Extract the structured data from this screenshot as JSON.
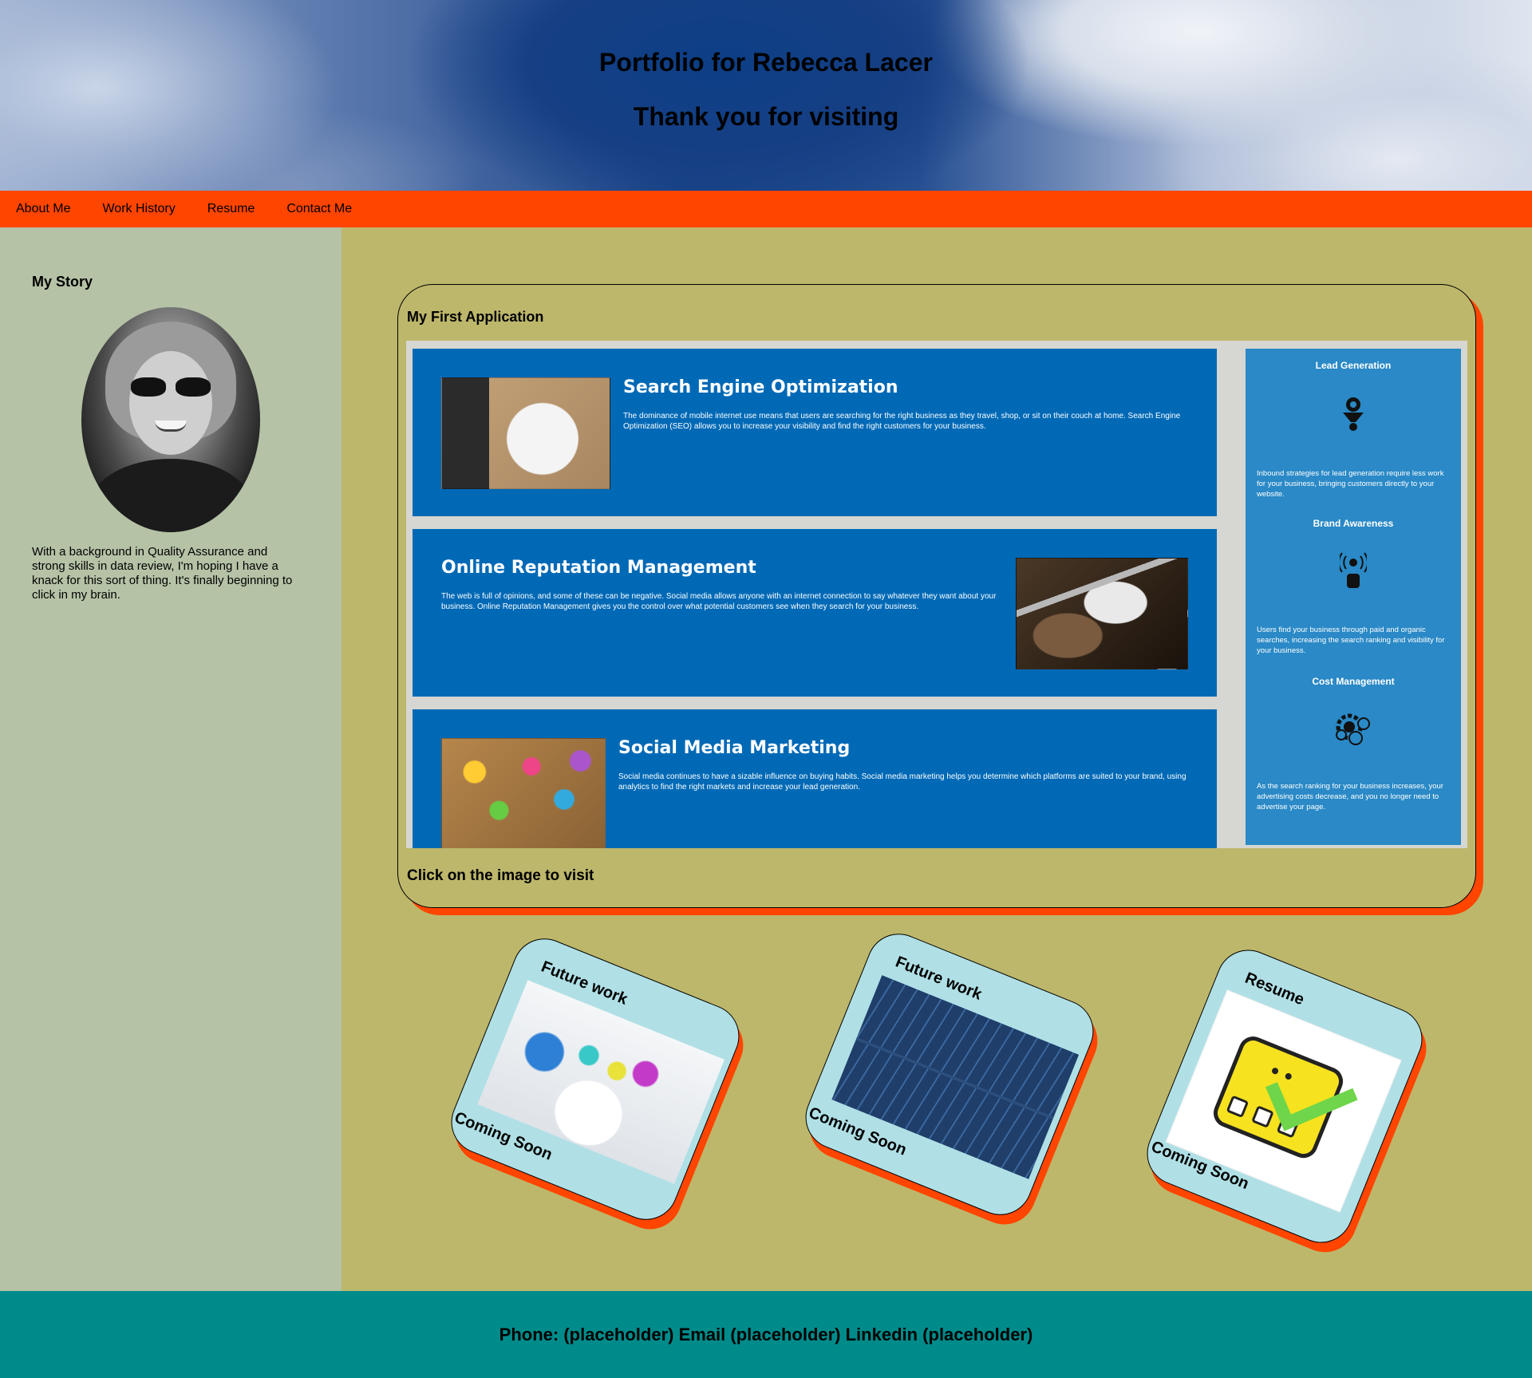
{
  "header": {
    "title": "Portfolio for Rebecca Lacer",
    "subtitle": "Thank you for visiting"
  },
  "nav": {
    "items": [
      "About Me",
      "Work History",
      "Resume",
      "Contact Me"
    ]
  },
  "sidebar": {
    "heading": "My Story",
    "story": "With a background in Quality Assurance and strong skills in data review, I'm hoping I have a knack for this sort of thing. It's finally beginning to click in my brain."
  },
  "main": {
    "title": "My First Application",
    "caption": "Click on the image to visit",
    "app": {
      "panels": [
        {
          "title": "Search Engine Optimization",
          "body": "The dominance of mobile internet use means that users are searching for the right business as they travel, shop, or sit on their couch at home. Search Engine Optimization (SEO) allows you to increase your visibility and find the right customers for your business."
        },
        {
          "title": "Online Reputation Management",
          "body": "The web is full of opinions, and some of these can be negative. Social media allows anyone with an internet connection to say whatever they want about your business. Online Reputation Management gives you the control over what potential customers see when they search for your business."
        },
        {
          "title": "Social Media Marketing",
          "body": "Social media continues to have a sizable influence on buying habits. Social media marketing helps you determine which platforms are suited to your brand, using analytics to find the right markets and increase your lead generation."
        }
      ],
      "benefits": [
        {
          "title": "Lead Generation",
          "body": "Inbound strategies for lead generation require less work for your business, bringing customers directly to your website.",
          "icon": "funnel-icon"
        },
        {
          "title": "Brand Awareness",
          "body": "Users find your business through paid and organic searches, increasing the search ranking and visibility for your business.",
          "icon": "broadcast-person-icon"
        },
        {
          "title": "Cost Management",
          "body": "As the search ranking for your business increases, your advertising costs decrease, and you no longer need to advertise your page.",
          "icon": "gear-dollar-icon"
        }
      ]
    }
  },
  "cards": [
    {
      "title": "Future work",
      "footer": "Coming Soon",
      "image": "lab-glassware-image"
    },
    {
      "title": "Future work",
      "footer": "Coming Soon",
      "image": "solar-panels-image"
    },
    {
      "title": "Resume",
      "footer": "Coming Soon",
      "image": "checklist-image"
    }
  ],
  "footer": {
    "contact": "Phone: (placeholder) Email (placeholder) Linkedin (placeholder)"
  },
  "colors": {
    "nav": "#ff4500",
    "sidebar": "#b5c2a6",
    "main_bg": "#bdb76b",
    "card_bg": "#b0e0e6",
    "footer": "#008b8b",
    "app_blue": "#0069b6"
  }
}
